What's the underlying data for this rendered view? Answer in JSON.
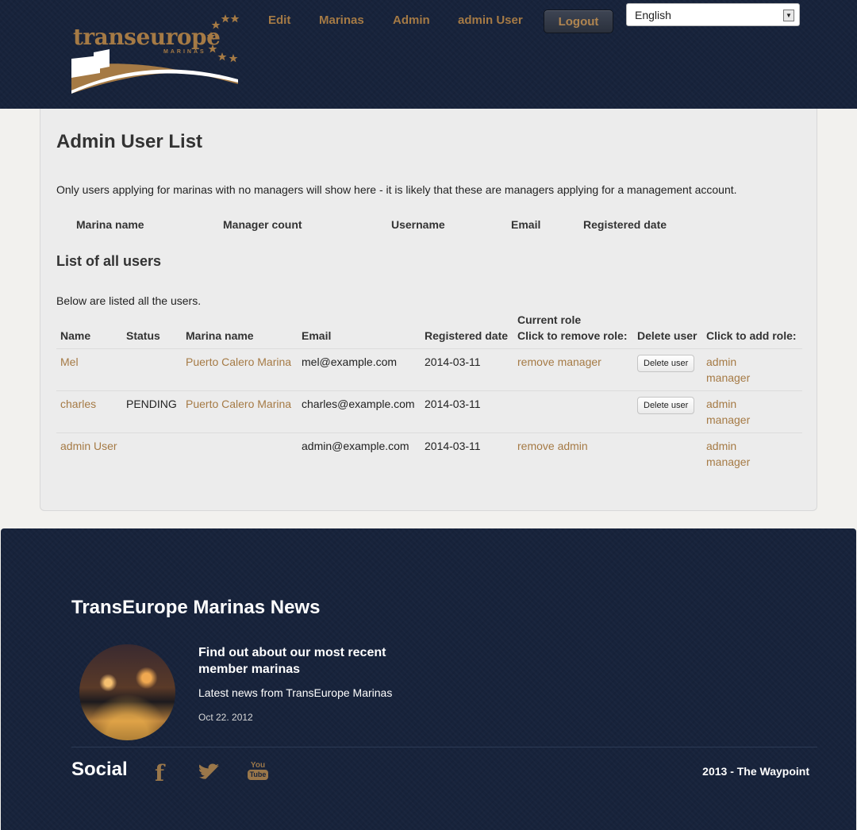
{
  "header": {
    "logo_text": "transeurope",
    "logo_sub": "MARINAS",
    "nav": [
      "Edit",
      "Marinas",
      "Admin",
      "admin User"
    ],
    "logout_label": "Logout",
    "language": "English",
    "colors": {
      "background": "#17233b",
      "accent": "#a57a45"
    }
  },
  "main": {
    "title": "Admin User List",
    "intro": "Only users applying for marinas with no managers will show here - it is likely that these are managers applying for a management account.",
    "pending_columns": [
      "Marina name",
      "Manager count",
      "Username",
      "Email",
      "Registered date"
    ],
    "all_users_title": "List of all users",
    "all_users_intro": "Below are listed all the users.",
    "columns": [
      "Name",
      "Status",
      "Marina name",
      "Email",
      "Registered date",
      "Current role",
      "Click to remove role:",
      "Delete user",
      "Click to add role:"
    ],
    "rows": [
      {
        "name": "Mel",
        "status": "",
        "marina": "Puerto Calero Marina",
        "email": "mel@example.com",
        "registered": "2014-03-11",
        "remove_role": "remove manager",
        "delete": "Delete user",
        "add_role_1": "admin",
        "add_role_2": "manager"
      },
      {
        "name": "charles",
        "status": "PENDING",
        "marina": "Puerto Calero Marina",
        "email": "charles@example.com",
        "registered": "2014-03-11",
        "remove_role": "",
        "delete": "Delete user",
        "add_role_1": "admin",
        "add_role_2": "manager"
      },
      {
        "name": "admin User",
        "status": "",
        "marina": "",
        "email": "admin@example.com",
        "registered": "2014-03-11",
        "remove_role": "remove admin",
        "delete": "",
        "add_role_1": "admin",
        "add_role_2": "manager"
      }
    ]
  },
  "footer": {
    "news_title": "TransEurope Marinas News",
    "news_headline": "Find out about our most recent member marinas",
    "news_subtitle": "Latest news from TransEurope Marinas",
    "news_date": "Oct 22. 2012",
    "social_title": "Social",
    "social_icons": [
      "facebook-icon",
      "twitter-icon",
      "youtube-icon"
    ],
    "youtube_top": "You",
    "youtube_bottom": "Tube",
    "copyright": "2013 - The Waypoint"
  }
}
